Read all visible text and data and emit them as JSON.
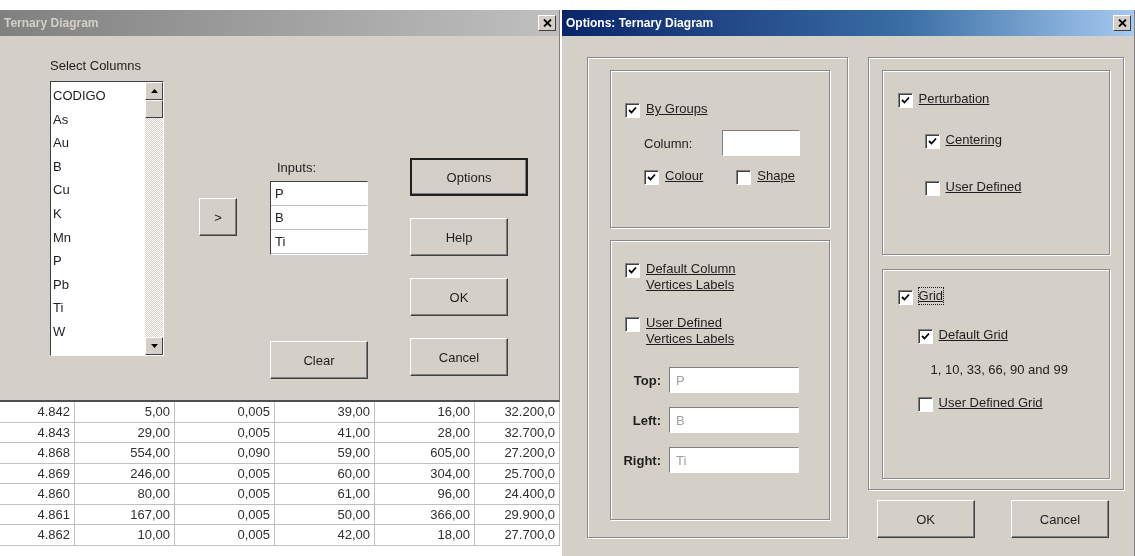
{
  "ternary_dialog": {
    "title": "Ternary Diagram",
    "active": false,
    "select_label": "Select Columns",
    "columns_list": [
      "CODIGO",
      "As",
      "Au",
      "B",
      "Cu",
      "K",
      "Mn",
      "P",
      "Pb",
      "Ti",
      "W"
    ],
    "move_button": ">",
    "inputs_label": "Inputs:",
    "inputs": [
      "P",
      "B",
      "Ti"
    ],
    "buttons": [
      {
        "label": "Options",
        "default": true
      },
      {
        "label": "Help",
        "default": false
      },
      {
        "label": "OK",
        "default": false
      },
      {
        "label": "Cancel",
        "default": false
      }
    ],
    "clear_button": "Clear"
  },
  "data_table": {
    "rows": [
      [
        "4.842",
        "5,00",
        "0,005",
        "39,00",
        "16,00",
        "32.200,0"
      ],
      [
        "4.843",
        "29,00",
        "0,005",
        "41,00",
        "28,00",
        "32.700,0"
      ],
      [
        "4.868",
        "554,00",
        "0,090",
        "59,00",
        "605,00",
        "27.200,0"
      ],
      [
        "4.869",
        "246,00",
        "0,005",
        "60,00",
        "304,00",
        "25.700,0"
      ],
      [
        "4.860",
        "80,00",
        "0,005",
        "61,00",
        "96,00",
        "24.400,0"
      ],
      [
        "4.861",
        "167,00",
        "0,005",
        "50,00",
        "366,00",
        "29.900,0"
      ],
      [
        "4.862",
        "10,00",
        "0,005",
        "42,00",
        "18,00",
        "27.700,0"
      ]
    ]
  },
  "options_dialog": {
    "title": "Options: Ternary Diagram",
    "active": true,
    "by_groups": {
      "label": "By Groups",
      "checked": true
    },
    "column_label": "Column:",
    "colour": {
      "label": "Colour",
      "checked": true
    },
    "shape": {
      "label": "Shape",
      "checked": false
    },
    "default_labels": {
      "label": "Default Column Vertices Labels",
      "checked": true
    },
    "user_labels": {
      "label": "User Defined Vertices Labels",
      "checked": false
    },
    "vertices": [
      {
        "label": "Top:",
        "value": "P"
      },
      {
        "label": "Left:",
        "value": "B"
      },
      {
        "label": "Right:",
        "value": "Ti"
      }
    ],
    "perturbation": {
      "label": "Perturbation",
      "checked": true
    },
    "centering": {
      "label": "Centering",
      "checked": true
    },
    "user_defined": {
      "label": "User Defined",
      "checked": false
    },
    "grid": {
      "label": "Grid",
      "checked": true,
      "focused": true
    },
    "default_grid": {
      "label": "Default Grid",
      "checked": true
    },
    "grid_note": "1, 10, 33, 66, 90 and 99",
    "user_grid": {
      "label": "User Defined Grid",
      "checked": false
    },
    "buttons": [
      "OK",
      "Cancel"
    ]
  }
}
